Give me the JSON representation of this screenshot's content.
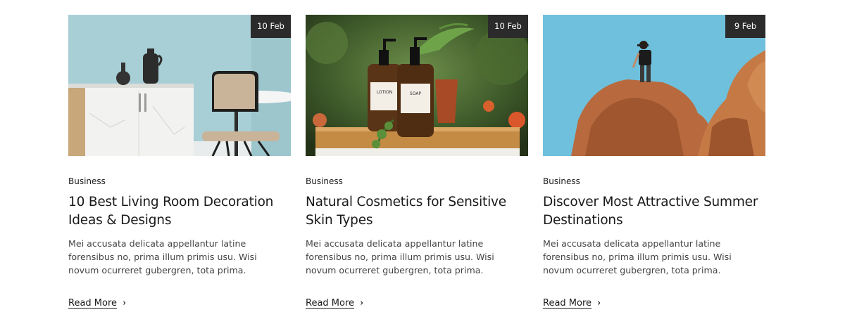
{
  "posts": [
    {
      "date": "10 Feb",
      "category": "Business",
      "title": "10 Best Living Room Decoration Ideas & Designs",
      "excerpt": "Mei accusata delicata appellantur latine forensibus no, prima illum primis usu. Wisi novum ocurreret gubergren, tota prima.",
      "read_more": "Read More",
      "image_icon": "living-room-image"
    },
    {
      "date": "10 Feb",
      "category": "Business",
      "title": "Natural Cosmetics for Sensitive Skin Types",
      "excerpt": "Mei accusata delicata appellantur latine forensibus no, prima illum primis usu. Wisi novum ocurreret gubergren, tota prima.",
      "read_more": "Read More",
      "image_icon": "cosmetics-image",
      "bottle_labels": [
        "LOTION",
        "SOAP"
      ]
    },
    {
      "date": "9 Feb",
      "category": "Business",
      "title": "Discover Most Attractive Summer Destinations",
      "excerpt": "Mei accusata delicata appellantur latine forensibus no, prima illum primis usu. Wisi novum ocurreret gubergren, tota prima.",
      "read_more": "Read More",
      "image_icon": "summer-rocks-image"
    }
  ],
  "colors": {
    "date_badge_bg": "#2b2b2b",
    "text": "#1a1a1a",
    "excerpt": "#444444"
  }
}
